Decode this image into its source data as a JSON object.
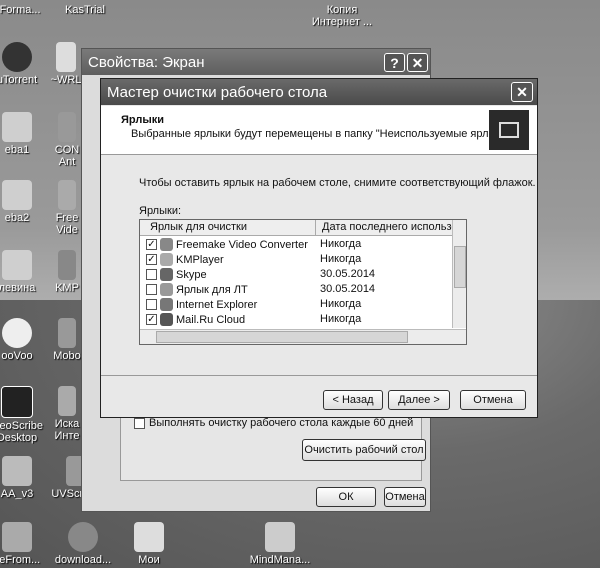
{
  "desktop_icons": [
    {
      "label": "eForma..."
    },
    {
      "label": "KasTrial"
    },
    {
      "label": "Копия"
    },
    {
      "label": "Интернет ..."
    },
    {
      "label": "uTorrent"
    },
    {
      "label": "~WRL"
    },
    {
      "label": "eba1"
    },
    {
      "label": "CON"
    },
    {
      "label": "Ant"
    },
    {
      "label": "eba2"
    },
    {
      "label": "Free"
    },
    {
      "label": "Vide"
    },
    {
      "label": "левина"
    },
    {
      "label": "KMP"
    },
    {
      "label": "ooVoo"
    },
    {
      "label": "Mobo"
    },
    {
      "label": "ideoScribe"
    },
    {
      "label": "Desktop"
    },
    {
      "label": "Иска"
    },
    {
      "label": "Инте"
    },
    {
      "label": "AA_v3"
    },
    {
      "label": "UVScreen..."
    },
    {
      "label": "veFrom..."
    },
    {
      "label": "download..."
    },
    {
      "label": "Мои"
    },
    {
      "label": "MindMana..."
    }
  ],
  "props_window": {
    "title": "Свойства: Экран",
    "help_btn": "?",
    "close_btn": "✕",
    "checkbox_label": "Выполнять очистку рабочего стола каждые 60 дней",
    "clean_btn": "Очистить рабочий стол",
    "ok_btn": "ОК",
    "cancel_btn": "Отмена"
  },
  "wizard": {
    "title": "Мастер очистки рабочего стола",
    "close_btn": "✕",
    "header_title": "Ярлыки",
    "header_desc": "Выбранные ярлыки будут перемещены в папку \"Неиспользуемые ярлыки\".",
    "instruction": "Чтобы оставить ярлык на рабочем столе, снимите соответствующий флажок.",
    "list_label": "Ярлыки:",
    "col1": "Ярлык для очистки",
    "col2": "Дата последнего использов",
    "rows": [
      {
        "name": "Freemake Video Converter",
        "date": "Никогда",
        "checked": true,
        "color": "#888"
      },
      {
        "name": "KMPlayer",
        "date": "Никогда",
        "checked": true,
        "color": "#aaa"
      },
      {
        "name": "Skype",
        "date": "30.05.2014",
        "checked": false,
        "color": "#666"
      },
      {
        "name": "Ярлык для ЛТ",
        "date": "30.05.2014",
        "checked": false,
        "color": "#999"
      },
      {
        "name": "Internet Explorer",
        "date": "Никогда",
        "checked": false,
        "color": "#777"
      },
      {
        "name": "Mail.Ru Cloud",
        "date": "Никогда",
        "checked": true,
        "color": "#555"
      }
    ],
    "back_btn": "< Назад",
    "next_btn": "Далее >",
    "cancel_btn": "Отмена"
  }
}
